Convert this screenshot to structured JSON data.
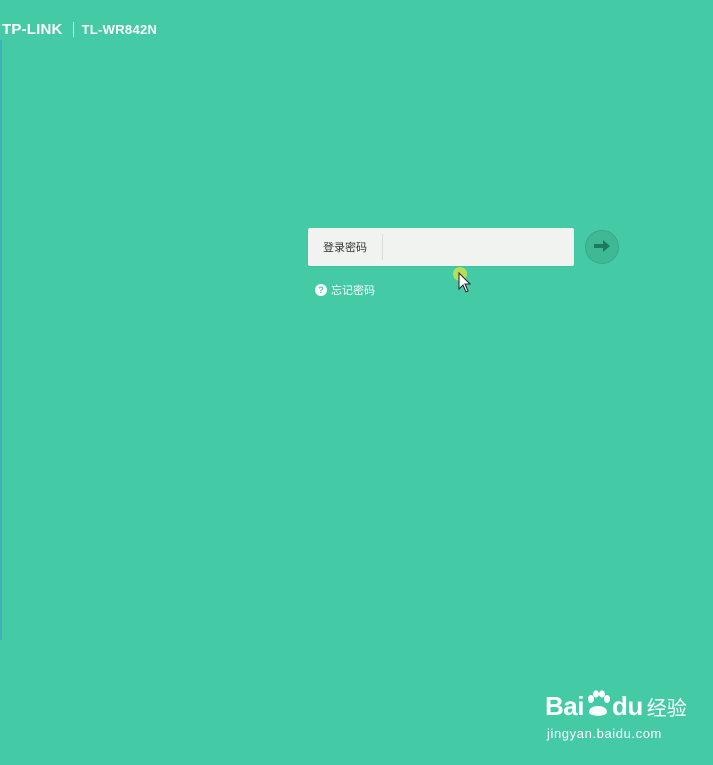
{
  "header": {
    "brand": "TP-LINK",
    "model": "TL-WR842N"
  },
  "login": {
    "label": "登录密码",
    "password_value": "",
    "submit_icon": "arrow-right-icon",
    "forgot_label": "忘记密码",
    "forgot_icon": "help-circle-icon"
  },
  "watermark": {
    "bai": "Bai",
    "du": "du",
    "jingyan": "经验",
    "url": "jingyan.baidu.com"
  },
  "colors": {
    "background": "#44cba6",
    "input_background": "#f1f3f1",
    "button": "#3fb894",
    "text_white": "#ffffff"
  }
}
